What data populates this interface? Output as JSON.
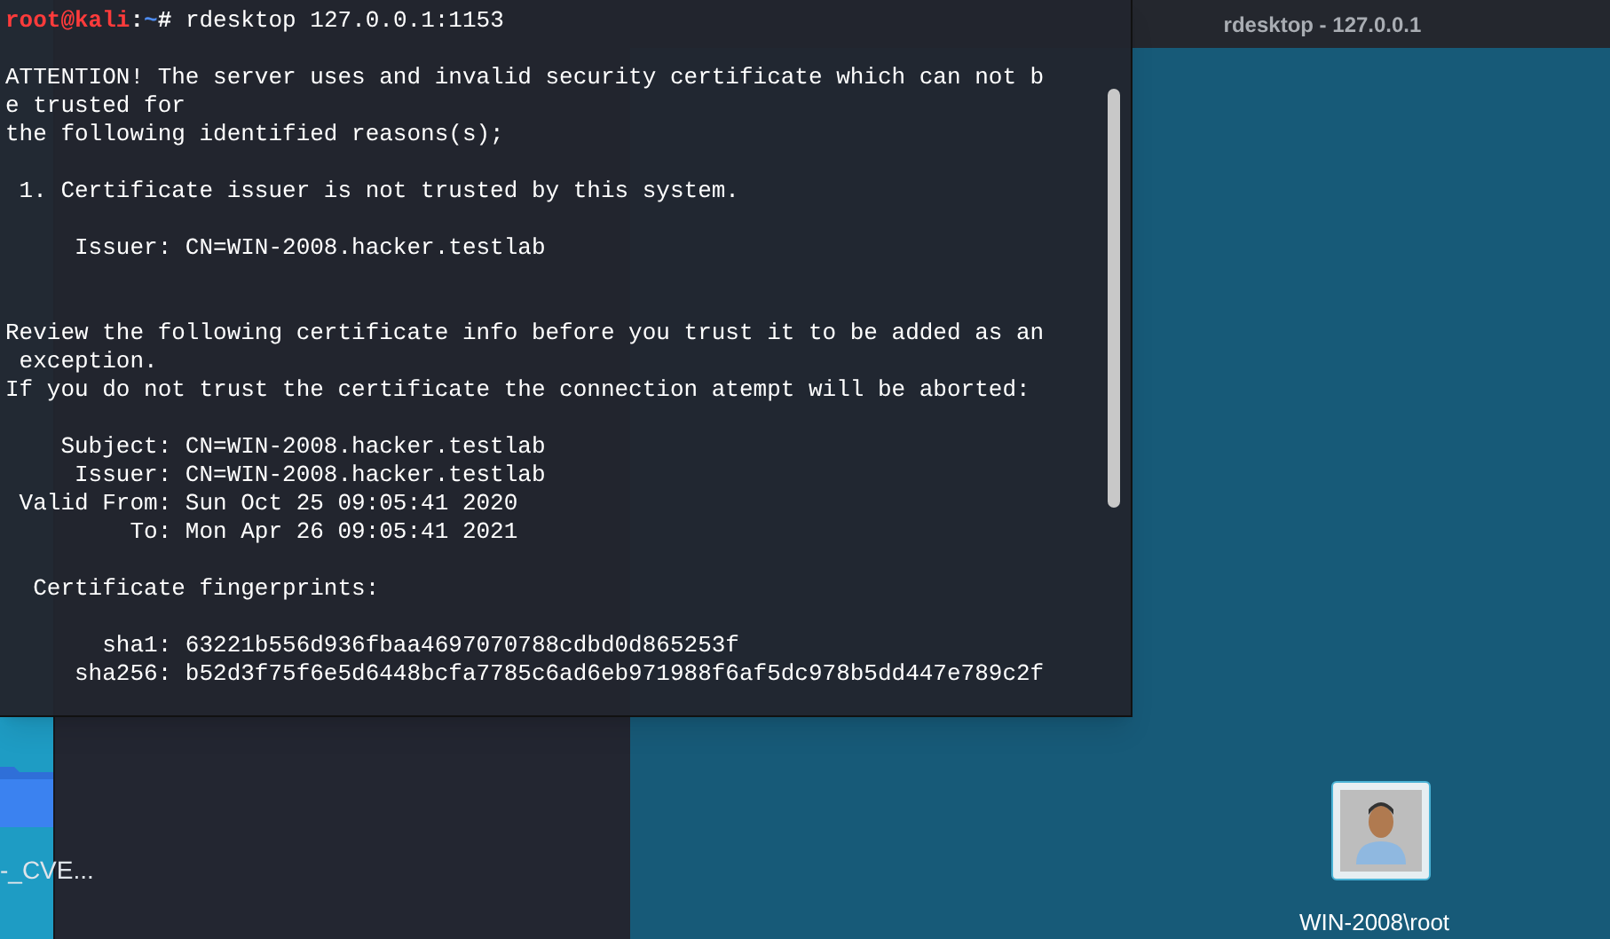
{
  "desktop": {
    "icon_label": "-_CVE..."
  },
  "rdesktop_window": {
    "title": "rdesktop - 127.0.0.1",
    "remote_desktop": {
      "user_tile_label": "WIN-2008\\root"
    }
  },
  "terminal": {
    "prompt": {
      "user": "root@kali",
      "separator": ":",
      "path": "~",
      "symbol": "#",
      "command": "rdesktop 127.0.0.1:1153"
    },
    "lines": [
      {
        "kind": "blank"
      },
      {
        "kind": "text",
        "text": "ATTENTION! The server uses and invalid security certificate which can not b"
      },
      {
        "kind": "text",
        "text": "e trusted for"
      },
      {
        "kind": "text",
        "text": "the following identified reasons(s);"
      },
      {
        "kind": "blank"
      },
      {
        "kind": "text",
        "text": " 1. Certificate issuer is not trusted by this system."
      },
      {
        "kind": "blank"
      },
      {
        "kind": "text",
        "text": "     Issuer: CN=WIN-2008.hacker.testlab"
      },
      {
        "kind": "blank"
      },
      {
        "kind": "blank"
      },
      {
        "kind": "text",
        "text": "Review the following certificate info before you trust it to be added as an"
      },
      {
        "kind": "text",
        "text": " exception."
      },
      {
        "kind": "text",
        "text": "If you do not trust the certificate the connection atempt will be aborted:"
      },
      {
        "kind": "blank"
      },
      {
        "kind": "text",
        "text": "    Subject: CN=WIN-2008.hacker.testlab"
      },
      {
        "kind": "text",
        "text": "     Issuer: CN=WIN-2008.hacker.testlab"
      },
      {
        "kind": "text",
        "text": " Valid From: Sun Oct 25 09:05:41 2020"
      },
      {
        "kind": "text",
        "text": "         To: Mon Apr 26 09:05:41 2021"
      },
      {
        "kind": "blank"
      },
      {
        "kind": "text",
        "text": "  Certificate fingerprints:"
      },
      {
        "kind": "blank"
      },
      {
        "kind": "text",
        "text": "       sha1: 63221b556d936fbaa4697070788cdbd0d865253f"
      },
      {
        "kind": "text",
        "text": "     sha256: b52d3f75f6e5d6448bcfa7785c6ad6eb971988f6af5dc978b5dd447e789c2f"
      }
    ]
  }
}
